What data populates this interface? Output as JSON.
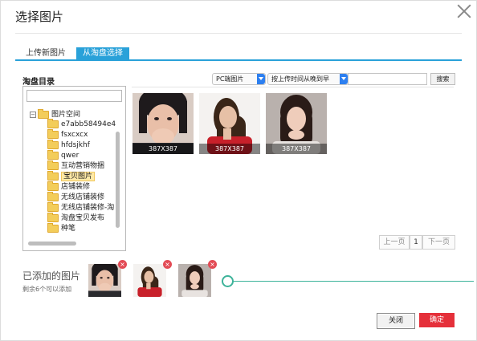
{
  "dialog": {
    "title": "选择图片",
    "close_icon": "close-icon"
  },
  "tabs": [
    {
      "label": "上传新图片",
      "active": false
    },
    {
      "label": "从淘盘选择",
      "active": true
    }
  ],
  "colors": {
    "accent_blue": "#29a1d9",
    "confirm_red": "#e5303a",
    "slider_green": "#3db39a",
    "folder_yellow": "#f3cd5a"
  },
  "tree": {
    "label": "淘盘目录",
    "root": "图片空间",
    "items": [
      {
        "label": "e7abb58494e4"
      },
      {
        "label": "fsxcxcx"
      },
      {
        "label": "hfdsjkhf"
      },
      {
        "label": "qwer"
      },
      {
        "label": "互动营销物捆"
      },
      {
        "label": "宝贝图片",
        "selected": true
      },
      {
        "label": "店铺装修"
      },
      {
        "label": "无线店铺装修"
      },
      {
        "label": "无线店铺装修-淘"
      },
      {
        "label": "淘盘宝贝发布"
      },
      {
        "label": "种笔"
      }
    ]
  },
  "filters": {
    "source_select": "PC端图片",
    "sort_select": "按上传时间从晚到早",
    "search_button": "搜索"
  },
  "images": [
    {
      "caption": "387X387"
    },
    {
      "caption": "387X387"
    },
    {
      "caption": "387X387"
    }
  ],
  "pagination": {
    "prev": "上一页",
    "page": "1",
    "next": "下一页"
  },
  "added": {
    "title": "已添加的图片",
    "subtitle": "剩余6个可以添加",
    "remove_symbol": "×"
  },
  "footer": {
    "close_label": "关闭",
    "confirm_label": "确定"
  }
}
